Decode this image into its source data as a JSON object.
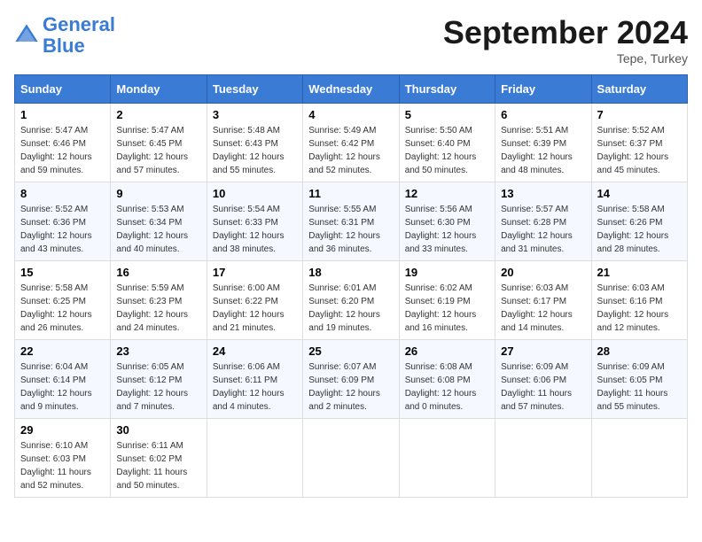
{
  "header": {
    "logo_text1": "General",
    "logo_text2": "Blue",
    "month": "September 2024",
    "location": "Tepe, Turkey"
  },
  "columns": [
    "Sunday",
    "Monday",
    "Tuesday",
    "Wednesday",
    "Thursday",
    "Friday",
    "Saturday"
  ],
  "weeks": [
    [
      {
        "day": "1",
        "sunrise": "5:47 AM",
        "sunset": "6:46 PM",
        "daylight": "12 hours and 59 minutes."
      },
      {
        "day": "2",
        "sunrise": "5:47 AM",
        "sunset": "6:45 PM",
        "daylight": "12 hours and 57 minutes."
      },
      {
        "day": "3",
        "sunrise": "5:48 AM",
        "sunset": "6:43 PM",
        "daylight": "12 hours and 55 minutes."
      },
      {
        "day": "4",
        "sunrise": "5:49 AM",
        "sunset": "6:42 PM",
        "daylight": "12 hours and 52 minutes."
      },
      {
        "day": "5",
        "sunrise": "5:50 AM",
        "sunset": "6:40 PM",
        "daylight": "12 hours and 50 minutes."
      },
      {
        "day": "6",
        "sunrise": "5:51 AM",
        "sunset": "6:39 PM",
        "daylight": "12 hours and 48 minutes."
      },
      {
        "day": "7",
        "sunrise": "5:52 AM",
        "sunset": "6:37 PM",
        "daylight": "12 hours and 45 minutes."
      }
    ],
    [
      {
        "day": "8",
        "sunrise": "5:52 AM",
        "sunset": "6:36 PM",
        "daylight": "12 hours and 43 minutes."
      },
      {
        "day": "9",
        "sunrise": "5:53 AM",
        "sunset": "6:34 PM",
        "daylight": "12 hours and 40 minutes."
      },
      {
        "day": "10",
        "sunrise": "5:54 AM",
        "sunset": "6:33 PM",
        "daylight": "12 hours and 38 minutes."
      },
      {
        "day": "11",
        "sunrise": "5:55 AM",
        "sunset": "6:31 PM",
        "daylight": "12 hours and 36 minutes."
      },
      {
        "day": "12",
        "sunrise": "5:56 AM",
        "sunset": "6:30 PM",
        "daylight": "12 hours and 33 minutes."
      },
      {
        "day": "13",
        "sunrise": "5:57 AM",
        "sunset": "6:28 PM",
        "daylight": "12 hours and 31 minutes."
      },
      {
        "day": "14",
        "sunrise": "5:58 AM",
        "sunset": "6:26 PM",
        "daylight": "12 hours and 28 minutes."
      }
    ],
    [
      {
        "day": "15",
        "sunrise": "5:58 AM",
        "sunset": "6:25 PM",
        "daylight": "12 hours and 26 minutes."
      },
      {
        "day": "16",
        "sunrise": "5:59 AM",
        "sunset": "6:23 PM",
        "daylight": "12 hours and 24 minutes."
      },
      {
        "day": "17",
        "sunrise": "6:00 AM",
        "sunset": "6:22 PM",
        "daylight": "12 hours and 21 minutes."
      },
      {
        "day": "18",
        "sunrise": "6:01 AM",
        "sunset": "6:20 PM",
        "daylight": "12 hours and 19 minutes."
      },
      {
        "day": "19",
        "sunrise": "6:02 AM",
        "sunset": "6:19 PM",
        "daylight": "12 hours and 16 minutes."
      },
      {
        "day": "20",
        "sunrise": "6:03 AM",
        "sunset": "6:17 PM",
        "daylight": "12 hours and 14 minutes."
      },
      {
        "day": "21",
        "sunrise": "6:03 AM",
        "sunset": "6:16 PM",
        "daylight": "12 hours and 12 minutes."
      }
    ],
    [
      {
        "day": "22",
        "sunrise": "6:04 AM",
        "sunset": "6:14 PM",
        "daylight": "12 hours and 9 minutes."
      },
      {
        "day": "23",
        "sunrise": "6:05 AM",
        "sunset": "6:12 PM",
        "daylight": "12 hours and 7 minutes."
      },
      {
        "day": "24",
        "sunrise": "6:06 AM",
        "sunset": "6:11 PM",
        "daylight": "12 hours and 4 minutes."
      },
      {
        "day": "25",
        "sunrise": "6:07 AM",
        "sunset": "6:09 PM",
        "daylight": "12 hours and 2 minutes."
      },
      {
        "day": "26",
        "sunrise": "6:08 AM",
        "sunset": "6:08 PM",
        "daylight": "12 hours and 0 minutes."
      },
      {
        "day": "27",
        "sunrise": "6:09 AM",
        "sunset": "6:06 PM",
        "daylight": "11 hours and 57 minutes."
      },
      {
        "day": "28",
        "sunrise": "6:09 AM",
        "sunset": "6:05 PM",
        "daylight": "11 hours and 55 minutes."
      }
    ],
    [
      {
        "day": "29",
        "sunrise": "6:10 AM",
        "sunset": "6:03 PM",
        "daylight": "11 hours and 52 minutes."
      },
      {
        "day": "30",
        "sunrise": "6:11 AM",
        "sunset": "6:02 PM",
        "daylight": "11 hours and 50 minutes."
      },
      null,
      null,
      null,
      null,
      null
    ]
  ]
}
